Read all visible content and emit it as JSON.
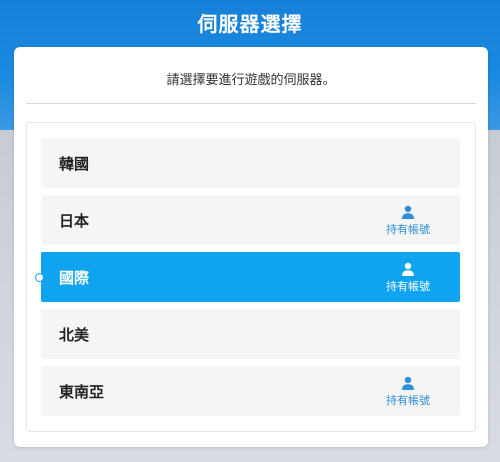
{
  "header": {
    "title": "伺服器選擇"
  },
  "prompt": "請選擇要進行遊戲的伺服器。",
  "servers": [
    {
      "name": "韓國",
      "has_account": false,
      "selected": false
    },
    {
      "name": "日本",
      "has_account": true,
      "account_label": "持有帳號",
      "selected": false
    },
    {
      "name": "國際",
      "has_account": true,
      "account_label": "持有帳號",
      "selected": true
    },
    {
      "name": "北美",
      "has_account": false,
      "selected": false
    },
    {
      "name": "東南亞",
      "has_account": true,
      "account_label": "持有帳號",
      "selected": false
    }
  ],
  "icons": {
    "account": "person-icon",
    "selection": "selection-dot"
  },
  "colors": {
    "header_blue": "#1c8ae0",
    "selected_row": "#10a4f0",
    "account_text": "#2f8fd9",
    "row_bg": "#f5f5f5"
  }
}
